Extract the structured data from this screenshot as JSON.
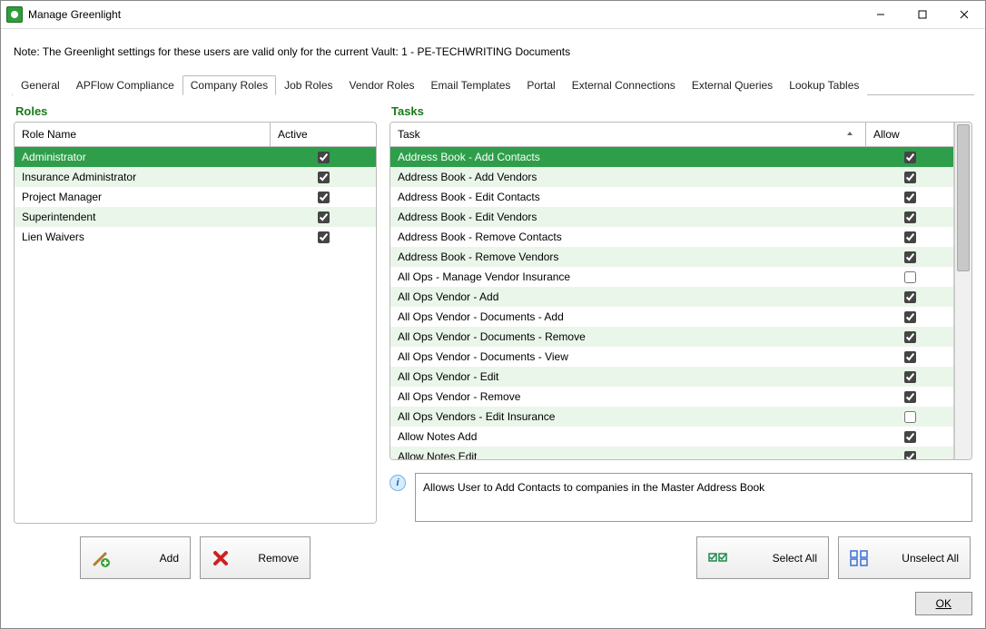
{
  "window": {
    "title": "Manage Greenlight"
  },
  "note": "Note:  The Greenlight settings for these users are valid only for the current Vault: 1 - PE-TECHWRITING Documents",
  "tabs": [
    {
      "label": "General"
    },
    {
      "label": "APFlow Compliance"
    },
    {
      "label": "Company Roles",
      "active": true
    },
    {
      "label": "Job Roles"
    },
    {
      "label": "Vendor Roles"
    },
    {
      "label": "Email Templates"
    },
    {
      "label": "Portal"
    },
    {
      "label": "External Connections"
    },
    {
      "label": "External Queries"
    },
    {
      "label": "Lookup Tables"
    }
  ],
  "roles": {
    "title": "Roles",
    "columns": {
      "name": "Role Name",
      "active": "Active"
    },
    "rows": [
      {
        "name": "Administrator",
        "active": true,
        "selected": true
      },
      {
        "name": "Insurance Administrator",
        "active": true
      },
      {
        "name": "Project Manager",
        "active": true
      },
      {
        "name": "Superintendent",
        "active": true
      },
      {
        "name": "Lien Waivers",
        "active": true
      }
    ],
    "buttons": {
      "add": "Add",
      "remove": "Remove"
    }
  },
  "tasks": {
    "title": "Tasks",
    "columns": {
      "task": "Task",
      "allow": "Allow"
    },
    "rows": [
      {
        "task": "Address Book - Add Contacts",
        "allow": true,
        "selected": true
      },
      {
        "task": "Address Book - Add Vendors",
        "allow": true
      },
      {
        "task": "Address Book - Edit Contacts",
        "allow": true
      },
      {
        "task": "Address Book - Edit Vendors",
        "allow": true
      },
      {
        "task": "Address Book - Remove Contacts",
        "allow": true
      },
      {
        "task": "Address Book - Remove Vendors",
        "allow": true
      },
      {
        "task": "All Ops - Manage Vendor Insurance",
        "allow": false
      },
      {
        "task": "All Ops Vendor - Add",
        "allow": true
      },
      {
        "task": "All Ops Vendor - Documents - Add",
        "allow": true
      },
      {
        "task": "All Ops Vendor - Documents - Remove",
        "allow": true
      },
      {
        "task": "All Ops Vendor - Documents - View",
        "allow": true
      },
      {
        "task": "All Ops Vendor - Edit",
        "allow": true
      },
      {
        "task": "All Ops Vendor - Remove",
        "allow": true
      },
      {
        "task": "All Ops Vendors - Edit Insurance",
        "allow": false
      },
      {
        "task": "Allow Notes Add",
        "allow": true
      },
      {
        "task": "Allow Notes Edit",
        "allow": true
      }
    ],
    "info": "Allows User to Add Contacts to companies in the Master Address Book",
    "buttons": {
      "selectAll": "Select All",
      "unselectAll": "Unselect All"
    }
  },
  "footer": {
    "ok": "OK"
  }
}
